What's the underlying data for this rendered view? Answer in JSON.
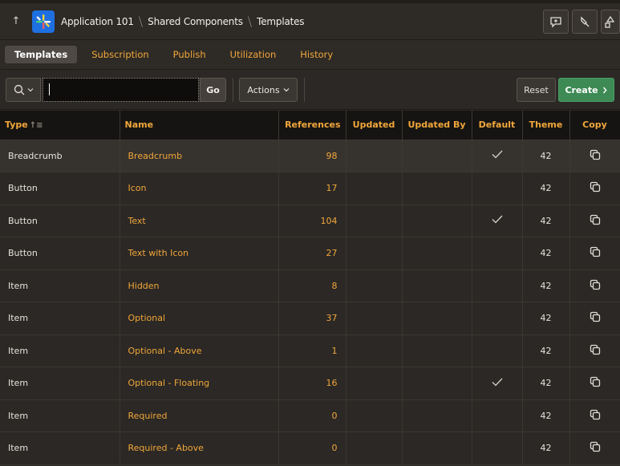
{
  "header": {
    "breadcrumbs": [
      "Application 101",
      "Shared Components",
      "Templates"
    ],
    "icons": [
      "up-arrow-icon",
      "app-logo-icon",
      "feedback-icon",
      "bookmark-icon",
      "shapes-icon"
    ]
  },
  "tabs": [
    {
      "label": "Templates",
      "active": true
    },
    {
      "label": "Subscription",
      "active": false
    },
    {
      "label": "Publish",
      "active": false
    },
    {
      "label": "Utilization",
      "active": false
    },
    {
      "label": "History",
      "active": false
    }
  ],
  "toolbar": {
    "search_value": "",
    "go_label": "Go",
    "actions_label": "Actions",
    "reset_label": "Reset",
    "create_label": "Create"
  },
  "table": {
    "columns": [
      "Type",
      "Name",
      "References",
      "Updated",
      "Updated By",
      "Default",
      "Theme",
      "Copy"
    ],
    "rows": [
      {
        "type": "Breadcrumb",
        "name": "Breadcrumb",
        "references": "98",
        "updated": "",
        "updated_by": "",
        "default": true,
        "theme": "42"
      },
      {
        "type": "Button",
        "name": "Icon",
        "references": "17",
        "updated": "",
        "updated_by": "",
        "default": false,
        "theme": "42"
      },
      {
        "type": "Button",
        "name": "Text",
        "references": "104",
        "updated": "",
        "updated_by": "",
        "default": true,
        "theme": "42"
      },
      {
        "type": "Button",
        "name": "Text with Icon",
        "references": "27",
        "updated": "",
        "updated_by": "",
        "default": false,
        "theme": "42"
      },
      {
        "type": "Item",
        "name": "Hidden",
        "references": "8",
        "updated": "",
        "updated_by": "",
        "default": false,
        "theme": "42"
      },
      {
        "type": "Item",
        "name": "Optional",
        "references": "37",
        "updated": "",
        "updated_by": "",
        "default": false,
        "theme": "42"
      },
      {
        "type": "Item",
        "name": "Optional - Above",
        "references": "1",
        "updated": "",
        "updated_by": "",
        "default": false,
        "theme": "42"
      },
      {
        "type": "Item",
        "name": "Optional - Floating",
        "references": "16",
        "updated": "",
        "updated_by": "",
        "default": true,
        "theme": "42"
      },
      {
        "type": "Item",
        "name": "Required",
        "references": "0",
        "updated": "",
        "updated_by": "",
        "default": false,
        "theme": "42"
      },
      {
        "type": "Item",
        "name": "Required - Above",
        "references": "0",
        "updated": "",
        "updated_by": "",
        "default": false,
        "theme": "42"
      }
    ]
  },
  "colors": {
    "accent": "#f1a73b",
    "create": "#3d8a55",
    "logo": "#1e6fe0"
  }
}
